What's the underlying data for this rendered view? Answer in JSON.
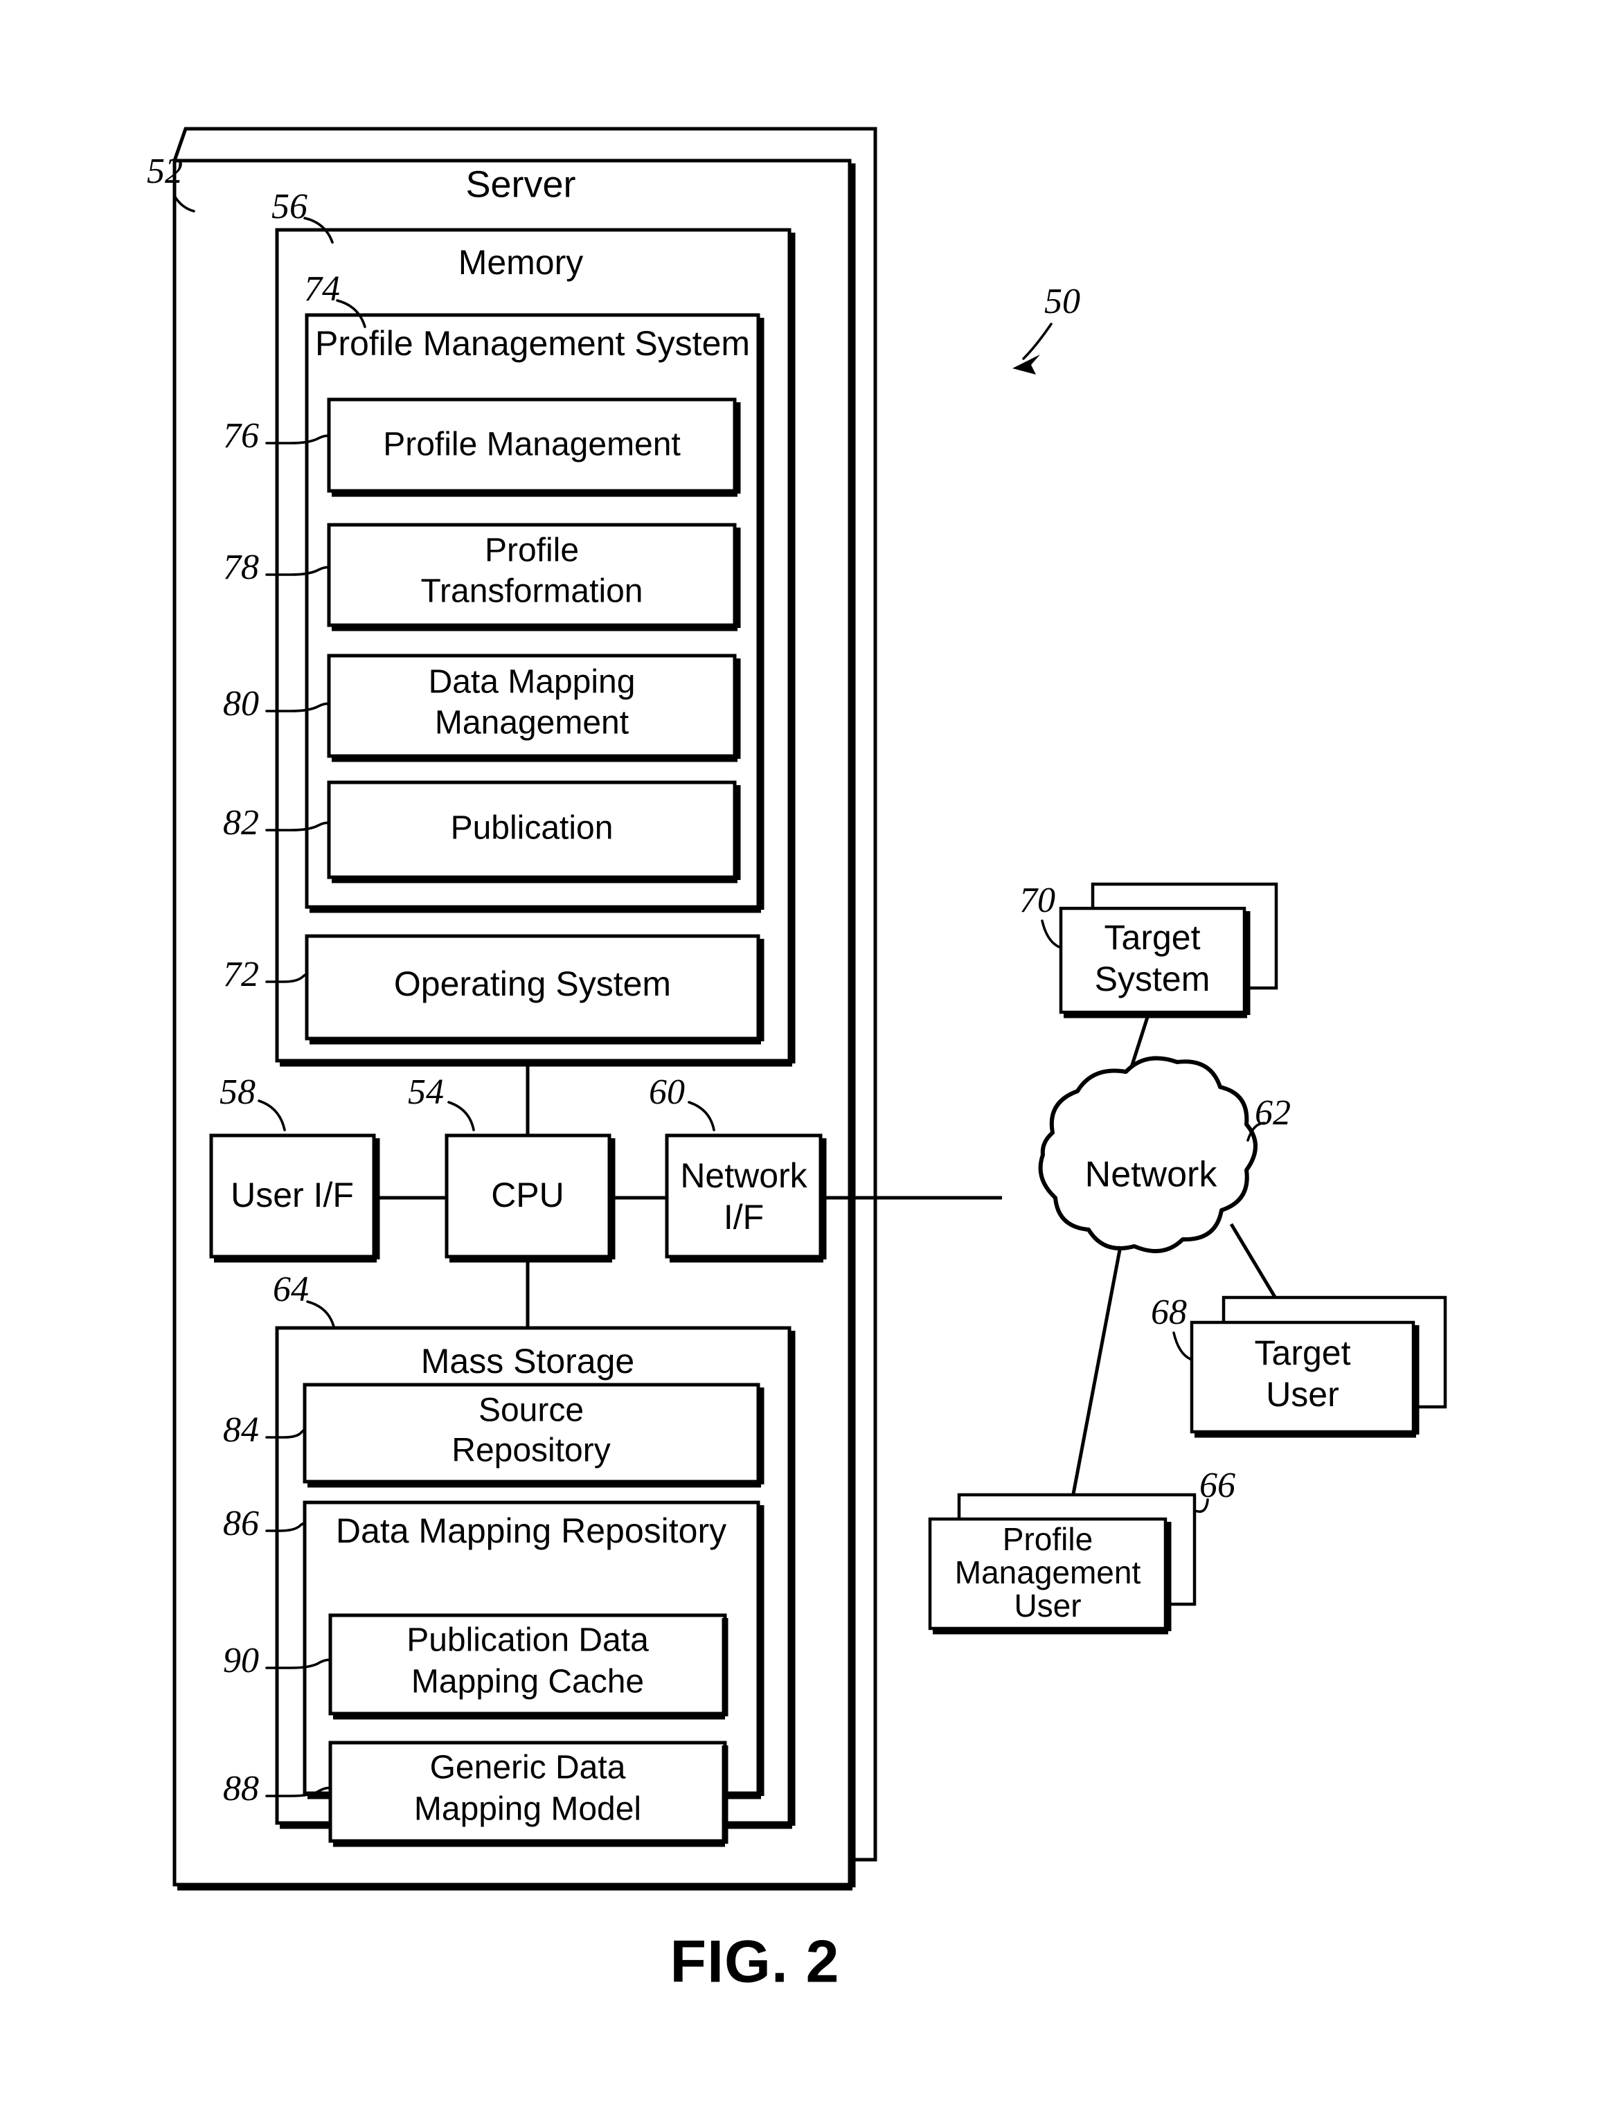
{
  "figure": {
    "caption": "FIG. 2",
    "overall_ref": "50"
  },
  "server": {
    "title": "Server",
    "ref": "52",
    "cpu": {
      "label": "CPU",
      "ref": "54"
    },
    "user_if": {
      "label": "User I/F",
      "ref": "58"
    },
    "network_if": {
      "label_line1": "Network",
      "label_line2": "I/F",
      "ref": "60"
    }
  },
  "memory": {
    "title": "Memory",
    "ref": "56",
    "profile_management_system": {
      "title": "Profile Management System",
      "ref": "74",
      "modules": [
        {
          "label": "Profile Management",
          "ref": "76",
          "lines": [
            "Profile Management"
          ]
        },
        {
          "label": "Profile Transformation",
          "ref": "78",
          "lines": [
            "Profile",
            "Transformation"
          ]
        },
        {
          "label": "Data Mapping Management",
          "ref": "80",
          "lines": [
            "Data Mapping",
            "Management"
          ]
        },
        {
          "label": "Publication",
          "ref": "82",
          "lines": [
            "Publication"
          ]
        }
      ]
    },
    "operating_system": {
      "label": "Operating System",
      "ref": "72"
    }
  },
  "mass_storage": {
    "title": "Mass Storage",
    "ref": "64",
    "source_repository": {
      "ref": "84",
      "lines": [
        "Source",
        "Repository"
      ]
    },
    "data_mapping_repository": {
      "title": "Data Mapping Repository",
      "ref": "86",
      "children": [
        {
          "ref": "90",
          "lines": [
            "Publication Data",
            "Mapping Cache"
          ]
        },
        {
          "ref": "88",
          "lines": [
            "Generic Data",
            "Mapping Model"
          ]
        }
      ]
    }
  },
  "network": {
    "label": "Network",
    "ref": "62"
  },
  "external_nodes": [
    {
      "name": "target-system",
      "ref": "70",
      "lines": [
        "Target",
        "System"
      ]
    },
    {
      "name": "target-user",
      "ref": "68",
      "lines": [
        "Target",
        "User"
      ]
    },
    {
      "name": "profile-management-user",
      "ref": "66",
      "lines": [
        "Profile",
        "Management",
        "User"
      ]
    }
  ],
  "style": {
    "line_color": "#000000",
    "fill_color": "#ffffff"
  }
}
